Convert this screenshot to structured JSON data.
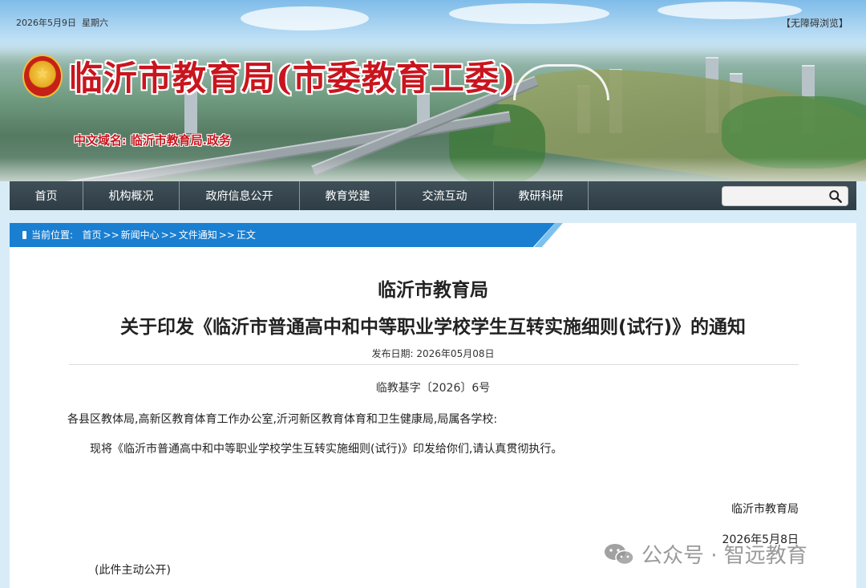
{
  "header": {
    "date": "2026年5月9日",
    "weekday": "星期六",
    "accessibility": "【无障碍浏览】",
    "site_title": "临沂市教育局(市委教育工委)",
    "domain_label": "中文域名: 临沂市教育局.政务"
  },
  "nav": {
    "items": [
      {
        "label": "首页"
      },
      {
        "label": "机构概况"
      },
      {
        "label": "政府信息公开"
      },
      {
        "label": "教育党建"
      },
      {
        "label": "交流互动"
      },
      {
        "label": "教研科研"
      }
    ],
    "search": {
      "placeholder": "",
      "value": ""
    }
  },
  "breadcrumb": {
    "prefix": "当前位置:",
    "items": [
      "首页",
      "新闻中心",
      "文件通知",
      "正文"
    ],
    "separator": ">>"
  },
  "article": {
    "title_line1": "临沂市教育局",
    "title_line2": "关于印发《临沂市普通高中和中等职业学校学生互转实施细则(试行)》的通知",
    "publish_date": "发布日期: 2026年05月08日",
    "doc_number": "临教基字〔2026〕6号",
    "recipients": "各县区教体局,高新区教育体育工作办公室,沂河新区教育体育和卫生健康局,局属各学校:",
    "body": "现将《临沂市普通高中和中等职业学校学生互转实施细则(试行)》印发给你们,请认真贯彻执行。",
    "signer": "临沂市教育局",
    "sign_date": "2026年5月8日",
    "note": "(此件主动公开)"
  },
  "watermark": {
    "text": "公众号 · 智远教育",
    "icon": "wechat-icon"
  },
  "colors": {
    "title_red": "#c9151e",
    "nav_bg": "#2f3d45",
    "breadcrumb_blue": "#1a7fd1",
    "page_bg": "#d8ecf7"
  }
}
